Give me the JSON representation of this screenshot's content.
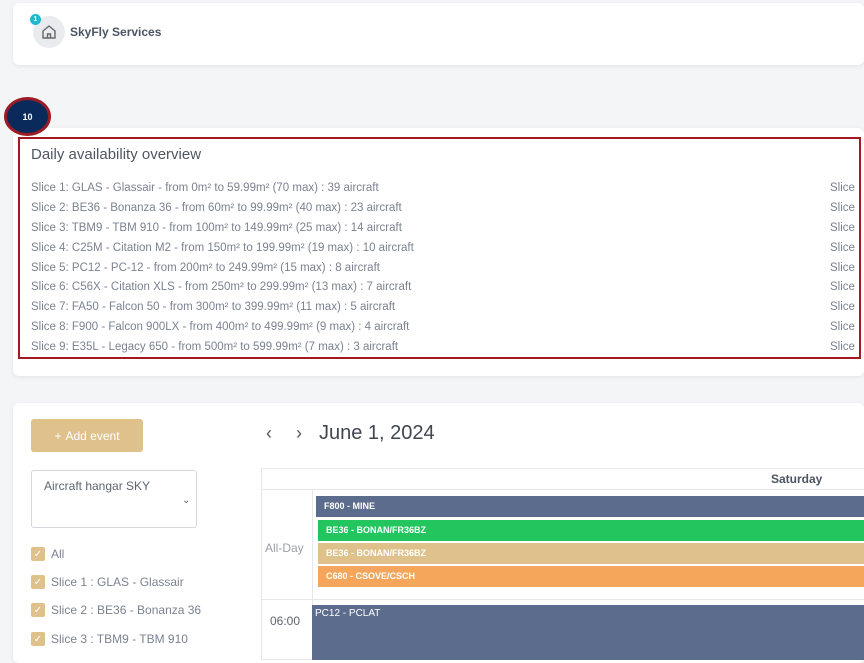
{
  "header": {
    "title": "SkyFly Services",
    "notification_count": "1"
  },
  "step_marker": "10",
  "availability": {
    "title": "Daily availability overview",
    "slices": [
      "Slice 1: GLAS - Glassair - from 0m² to 59.99m² (70 max) : 39 aircraft",
      "Slice 2: BE36 - Bonanza 36 - from 60m² to 99.99m² (40 max) : 23 aircraft",
      "Slice 3: TBM9 - TBM 910 - from 100m² to 149.99m² (25 max) : 14 aircraft",
      "Slice 4: C25M - Citation M2 - from 150m² to 199.99m² (19 max) : 10 aircraft",
      "Slice 5: PC12 - PC-12 - from 200m² to 249.99m² (15 max) : 8 aircraft",
      "Slice 6: C56X - Citation XLS - from 250m² to 299.99m² (13 max) : 7 aircraft",
      "Slice 7: FA50 - Falcon 50 - from 300m² to 399.99m² (11 max) : 5 aircraft",
      "Slice 8: F900 - Falcon 900LX - from 400m² to 499.99m² (9 max) : 4 aircraft",
      "Slice 9: E35L - Legacy 650 - from 500m² to 599.99m² (7 max) : 3 aircraft"
    ],
    "right_column_label": "Slice"
  },
  "calendar": {
    "add_event_label": "Add event",
    "hangar_select_value": "Aircraft hangar SKY",
    "filters": [
      "All",
      "Slice 1 : GLAS - Glassair",
      "Slice 2 : BE36 - Bonanza 36",
      "Slice 3 : TBM9 - TBM 910"
    ],
    "date_label": "June 1, 2024",
    "prev_arrow": "‹",
    "next_arrow": "›",
    "day_name": "Saturday",
    "allday_label": "All-Day",
    "time_slot": "06:00",
    "allday_events": [
      {
        "label": "F800 - MINE",
        "color": "#5c6c8c"
      },
      {
        "label": "BE36 - BONAN/FR36BZ",
        "color": "#22c55e"
      },
      {
        "label": "BE36 - BONAN/FR36BZ",
        "color": "#dec18b"
      },
      {
        "label": "C680 - CSOVE/CSCH",
        "color": "#f6a65b"
      }
    ],
    "timed_event": {
      "label": "PC12 - PCLAT",
      "color": "#5c6c8c"
    }
  }
}
